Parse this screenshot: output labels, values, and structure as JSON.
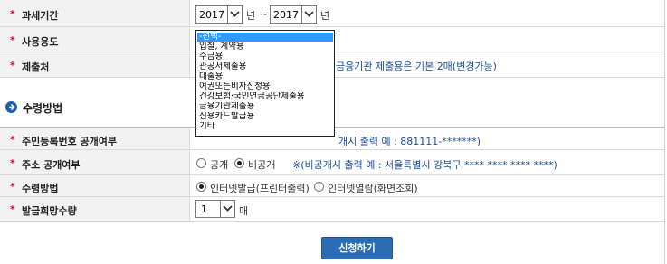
{
  "form": {
    "rows": {
      "period": {
        "label": "과세기간",
        "from_year": "2017",
        "from_unit": "년",
        "separator": "~",
        "to_year": "2017",
        "to_unit": "년"
      },
      "usage": {
        "label": "사용용도"
      },
      "submit_to": {
        "label": "제출처",
        "note_visible": "금융기관 제출용은 기본 2매(변경가능)"
      }
    },
    "usage_dropdown": {
      "options": [
        "-선택-",
        "입찰, 계약용",
        "수금용",
        "관공서제출용",
        "대출용",
        "여권또는비자신청용",
        "건강보험·국민연금공단제출용",
        "금융기관제출용",
        "신용카드발급용",
        "기타"
      ],
      "selected_index": 0
    },
    "receive_section": {
      "title": "수령방법",
      "rows": {
        "rrn_public": {
          "label": "주민등록번호 공개여부",
          "note_visible": "개시 출력 예 : 881111-*******)"
        },
        "address_public": {
          "label": "주소 공개여부",
          "option_public": "공개",
          "option_private": "비공개",
          "selected": "비공개",
          "note": "※(비공개시 출력 예 : 서울특별시 강북구 **** **** **** ****)"
        },
        "receive_method": {
          "label": "수령방법",
          "option_print": "인터넷발급(프린터출력)",
          "option_view": "인터넷열람(화면조회)",
          "selected": "인터넷발급(프린터출력)"
        },
        "copies": {
          "label": "발급희망수량",
          "value": "1",
          "unit": "매"
        }
      }
    },
    "submit_label": "신청하기"
  },
  "colors": {
    "accent": "#2a6db6",
    "required_star": "#e0003c",
    "dropdown_highlight": "#3399ff"
  },
  "icons": {
    "section": "arrow-circle-icon",
    "select_arrow": "chevron-down-icon"
  }
}
